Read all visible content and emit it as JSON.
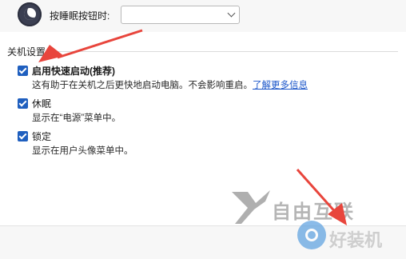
{
  "header": {
    "sleep_button_label": "按睡眠按钮时:",
    "dropdown_value": ""
  },
  "section": {
    "title": "关机设置"
  },
  "options": [
    {
      "label": "启用快速启动(推荐)",
      "checked": true,
      "description": "这有助于在关机之后更快地启动电脑。不会影响重启。",
      "link": "了解更多信息"
    },
    {
      "label": "休眠",
      "checked": true,
      "description": "显示在“电源”菜单中。"
    },
    {
      "label": "锁定",
      "checked": true,
      "description": "显示在用户头像菜单中。"
    }
  ],
  "watermark": {
    "text": "自由互联",
    "text2": "好装机"
  },
  "colors": {
    "accent": "#1f5fbf",
    "arrow": "#e8453c",
    "link": "#1a55c9"
  }
}
